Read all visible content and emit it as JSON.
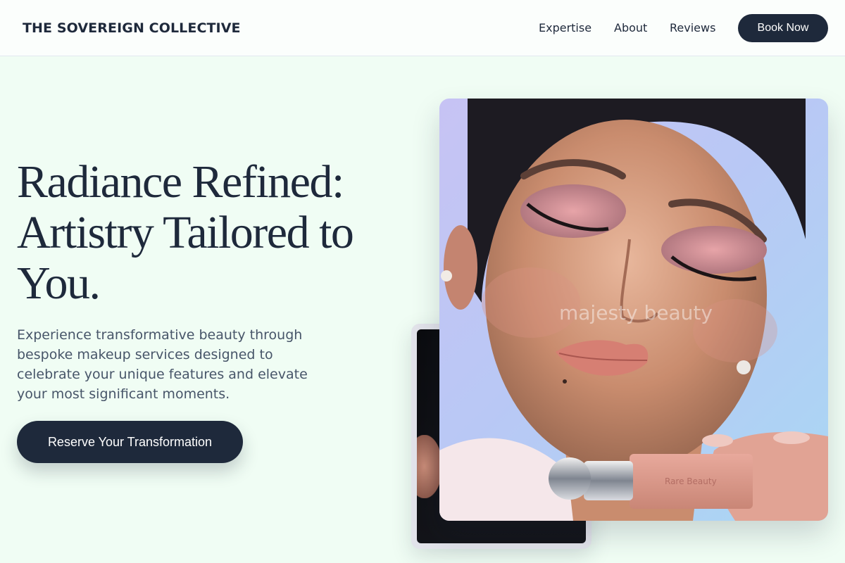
{
  "header": {
    "logo": "THE SOVEREIGN COLLECTIVE",
    "nav": [
      "Expertise",
      "About",
      "Reviews"
    ],
    "book_label": "Book Now"
  },
  "hero": {
    "title": "Radiance Refined: Artistry Tailored to You.",
    "subtitle": "Experience transformative beauty through bespoke makeup services designed to celebrate your unique features and elevate your most significant moments.",
    "cta_label": "Reserve Your Transformation"
  },
  "photo": {
    "watermark": "majesty beauty",
    "product_label": "Rare Beauty"
  },
  "colors": {
    "background": "#f0fdf4",
    "primary": "#1e293b",
    "text_muted": "#475569"
  }
}
